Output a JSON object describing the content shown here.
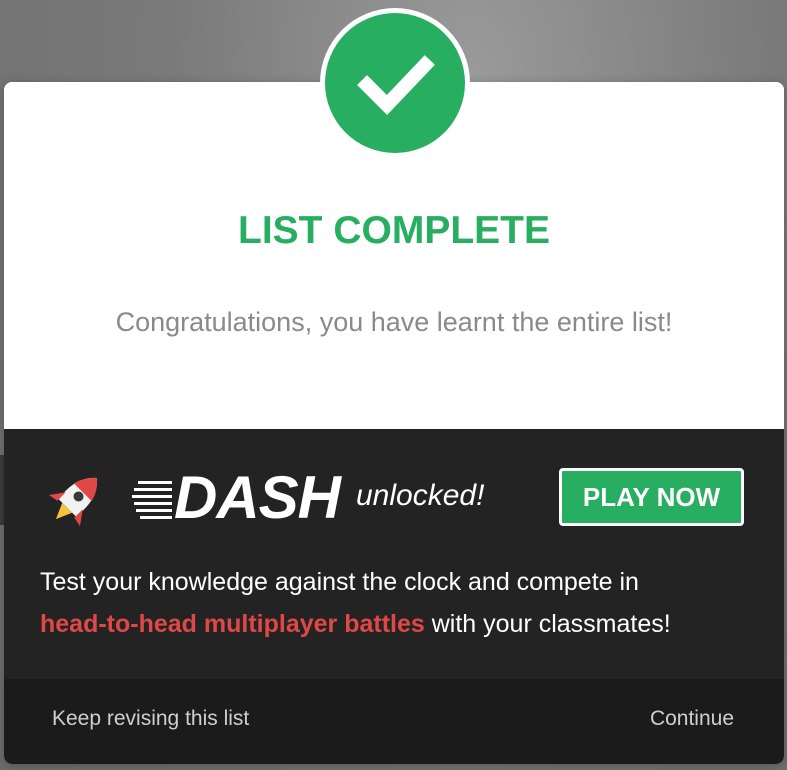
{
  "modal": {
    "title": "LIST COMPLETE",
    "message": "Congratulations, you have learnt the entire list!"
  },
  "promo": {
    "logo_text": "DASH",
    "unlocked_text": "unlocked!",
    "play_button_label": "PLAY NOW",
    "description_line1": "Test your knowledge against the clock and compete in",
    "highlight": "head-to-head multiplayer battles",
    "description_end": " with your classmates!"
  },
  "footer": {
    "keep_revising_label": "Keep revising this list",
    "continue_label": "Continue"
  },
  "colors": {
    "accent_green": "#27ae60",
    "highlight_red": "#e04848",
    "promo_bg": "#232323",
    "footer_bg": "#1b1b1b"
  },
  "icons": [
    "checkmark-icon",
    "rocket-icon",
    "dash-logo"
  ]
}
